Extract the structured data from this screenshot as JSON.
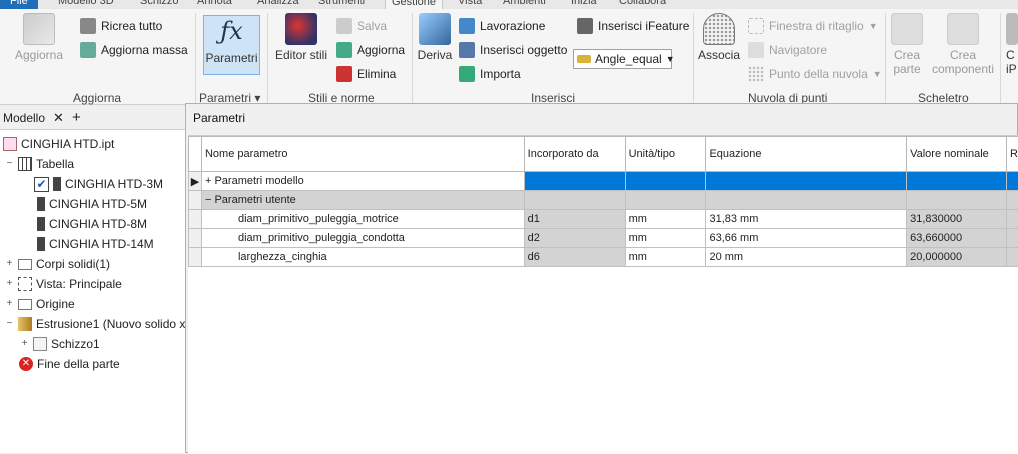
{
  "tabs": [
    "File",
    "Modello 3D",
    "Schizzo",
    "Annota",
    "Analizza",
    "Strumenti",
    "Gestione",
    "Vista",
    "Ambienti",
    "Inizia",
    "Collabora"
  ],
  "ribbon": {
    "aggiorna_big": "Aggiorna",
    "ricrea_tutto": "Ricrea tutto",
    "aggiorna_massa": "Aggiorna massa",
    "group_aggiorna": "Aggiorna",
    "parametri_big": "Parametri",
    "group_parametri": "Parametri",
    "editor_stili": "Editor stili",
    "salva": "Salva",
    "aggiorna": "Aggiorna",
    "elimina": "Elimina",
    "group_stili": "Stili e norme",
    "deriva": "Deriva",
    "lavorazione": "Lavorazione",
    "inserisci_oggetto": "Inserisci oggetto",
    "importa": "Importa",
    "inserisci_ifeature": "Inserisci iFeature",
    "combo_value": "Angle_equal",
    "group_inserisci": "Inserisci",
    "associa": "Associa",
    "finestra_ritaglio": "Finestra di ritaglio",
    "navigatore": "Navigatore",
    "punto_nuvola": "Punto della nuvola",
    "group_nuvola": "Nuvola di punti",
    "crea_parte_1": "Crea",
    "crea_parte_2": "parte",
    "crea_comp_1": "Crea",
    "crea_comp_2": "componenti",
    "group_scheletro": "Scheletro",
    "crea_ipart_1": "C",
    "crea_ipart_2": "iP"
  },
  "panel": {
    "tab_label": "Modello",
    "tree": [
      {
        "label": "CINGHIA HTD.ipt"
      },
      {
        "label": "Tabella"
      },
      {
        "label": "CINGHIA HTD-3M"
      },
      {
        "label": "CINGHIA HTD-5M"
      },
      {
        "label": "CINGHIA HTD-8M"
      },
      {
        "label": "CINGHIA HTD-14M"
      },
      {
        "label": "Corpi solidi(1)"
      },
      {
        "label": "Vista: Principale"
      },
      {
        "label": "Origine"
      },
      {
        "label": "Estrusione1 (Nuovo solido x lar"
      },
      {
        "label": "Schizzo1"
      },
      {
        "label": "Fine della parte"
      }
    ]
  },
  "dialog": {
    "title": "Parametri",
    "columns": [
      "Nome parametro",
      "Incorporato da",
      "Unità/tipo",
      "Equazione",
      "Valore nominale",
      "R"
    ],
    "groups": [
      "Parametri modello",
      "Parametri utente"
    ],
    "rows": [
      {
        "name": "diam_primitivo_puleggia_motrice",
        "by": "d1",
        "unit": "mm",
        "eq": "31,83 mm",
        "nominal": "31,830000"
      },
      {
        "name": "diam_primitivo_puleggia_condotta",
        "by": "d2",
        "unit": "mm",
        "eq": "63,66 mm",
        "nominal": "63,660000"
      },
      {
        "name": "larghezza_cinghia",
        "by": "d6",
        "unit": "mm",
        "eq": "20 mm",
        "nominal": "20,000000"
      }
    ]
  },
  "colors": {
    "accent": "#0078d7",
    "file_tab": "#1e6fb8",
    "selected_button": "#cfe3f7"
  }
}
